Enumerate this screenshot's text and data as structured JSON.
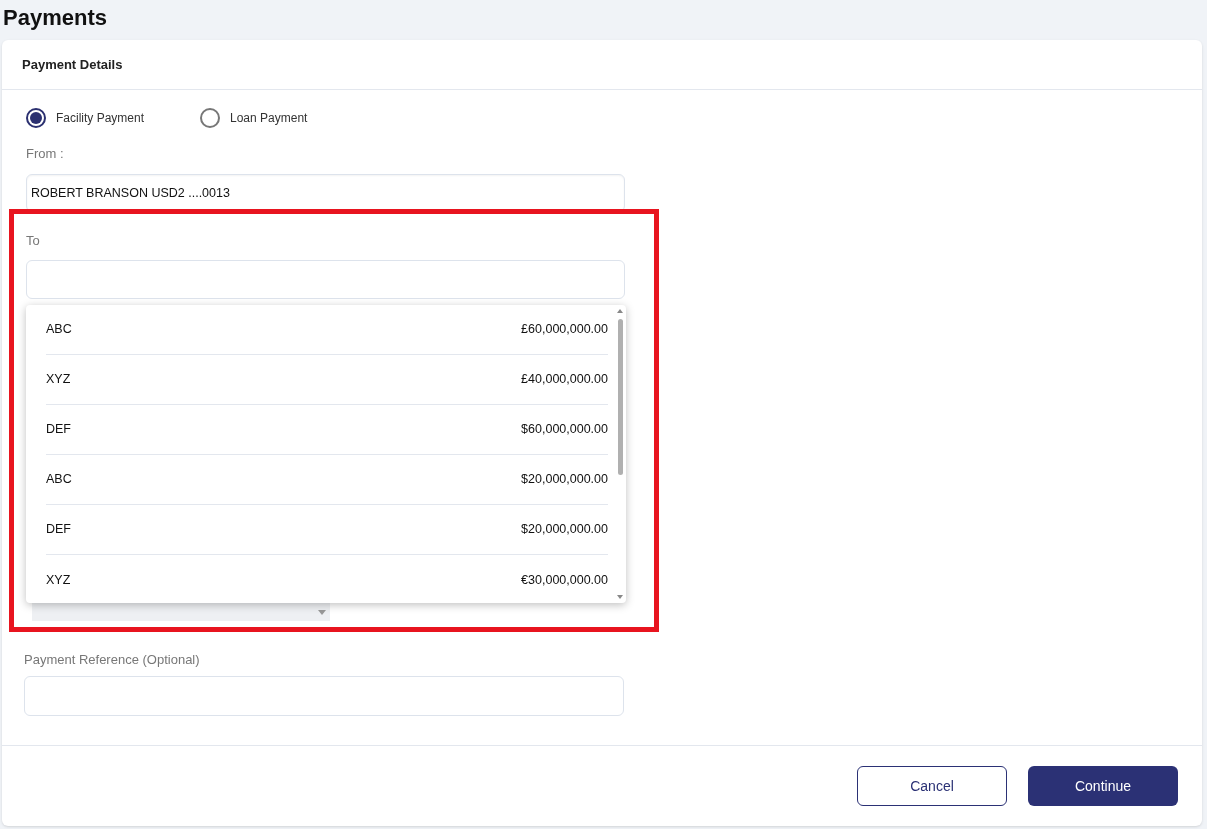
{
  "page_title": "Payments",
  "card": {
    "title": "Payment Details"
  },
  "payment_types": [
    {
      "label": "Facility Payment",
      "selected": true
    },
    {
      "label": "Loan Payment",
      "selected": false
    }
  ],
  "from": {
    "label": "From :",
    "value": "ROBERT BRANSON USD2 ....0013"
  },
  "to": {
    "label": "To",
    "expanded": true,
    "options": [
      {
        "name": "ABC",
        "amount": "£60,000,000.00"
      },
      {
        "name": "XYZ",
        "amount": "£40,000,000.00"
      },
      {
        "name": "DEF",
        "amount": "$60,000,000.00"
      },
      {
        "name": "ABC",
        "amount": "$20,000,000.00"
      },
      {
        "name": "DEF",
        "amount": "$20,000,000.00"
      },
      {
        "name": "XYZ",
        "amount": "€30,000,000.00"
      }
    ]
  },
  "reference": {
    "label": "Payment Reference (Optional)"
  },
  "buttons": [
    {
      "label": "Cancel",
      "kind": "secondary"
    },
    {
      "label": "Continue",
      "kind": "primary"
    }
  ]
}
